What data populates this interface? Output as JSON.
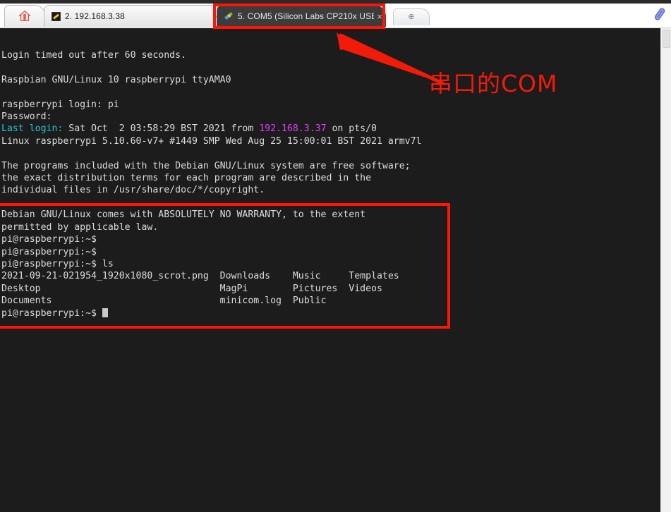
{
  "tabbar": {
    "home_tab": {
      "name": "home-tab",
      "icon": "home-icon",
      "label": ""
    },
    "tabs": [
      {
        "label": "2. 192.168.3.38",
        "icon": "ssh-session-icon",
        "close_label": "×",
        "active": false
      },
      {
        "label": "5. COM5  (Silicon Labs CP210x USB",
        "icon": "serial-plug-icon",
        "close_label": "×",
        "active": true
      }
    ],
    "new_tab_label": "⊕",
    "clip_icon": "paperclip-icon"
  },
  "terminal": {
    "lines": [
      {
        "segments": [
          {
            "text": "Login timed out after 60 seconds."
          }
        ]
      },
      {
        "segments": [
          {
            "text": ""
          }
        ]
      },
      {
        "segments": [
          {
            "text": "Raspbian GNU/Linux 10 raspberrypi ttyAMA0"
          }
        ]
      },
      {
        "segments": [
          {
            "text": ""
          }
        ]
      },
      {
        "segments": [
          {
            "text": "raspberrypi login: pi"
          }
        ]
      },
      {
        "segments": [
          {
            "text": "Password:"
          }
        ]
      },
      {
        "segments": [
          {
            "text": "Last login:",
            "color": "cyan"
          },
          {
            "text": " Sat Oct  2 03:58:29 BST 2021 from "
          },
          {
            "text": "192.168.3.37",
            "color": "magenta"
          },
          {
            "text": " on pts/0"
          }
        ]
      },
      {
        "segments": [
          {
            "text": "Linux raspberrypi 5.10.60-v7+ #1449 SMP Wed Aug 25 15:00:01 BST 2021 armv7l"
          }
        ]
      },
      {
        "segments": [
          {
            "text": ""
          }
        ]
      },
      {
        "segments": [
          {
            "text": "The programs included with the Debian GNU/Linux system are free software;"
          }
        ]
      },
      {
        "segments": [
          {
            "text": "the exact distribution terms for each program are described in the"
          }
        ]
      },
      {
        "segments": [
          {
            "text": "individual files in /usr/share/doc/*/copyright."
          }
        ]
      },
      {
        "segments": [
          {
            "text": ""
          }
        ]
      },
      {
        "segments": [
          {
            "text": "Debian GNU/Linux comes with ABSOLUTELY NO WARRANTY, to the extent"
          }
        ]
      },
      {
        "segments": [
          {
            "text": "permitted by applicable law."
          }
        ]
      },
      {
        "segments": [
          {
            "text": "pi@raspberrypi:~$"
          }
        ]
      },
      {
        "segments": [
          {
            "text": "pi@raspberrypi:~$"
          }
        ]
      },
      {
        "segments": [
          {
            "text": "pi@raspberrypi:~$ ls"
          }
        ]
      },
      {
        "segments": [
          {
            "text": "2021-09-21-021954_1920x1080_scrot.png  Downloads    Music     Templates"
          }
        ]
      },
      {
        "segments": [
          {
            "text": "Desktop                                MagPi        Pictures  Videos"
          }
        ]
      },
      {
        "segments": [
          {
            "text": "Documents                              minicom.log  Public"
          }
        ]
      },
      {
        "segments": [
          {
            "text": "pi@raspberrypi:~$ ",
            "cursor": true
          }
        ]
      }
    ],
    "prompt": "pi@raspberrypi:~$",
    "last_command": "ls",
    "ls_output": {
      "col1": [
        "2021-09-21-021954_1920x1080_scrot.png",
        "Desktop",
        "Documents"
      ],
      "col2": [
        "Downloads",
        "MagPi",
        "minicom.log"
      ],
      "col3": [
        "Music",
        "Pictures",
        "Public"
      ],
      "col4": [
        "Templates",
        "Videos"
      ]
    },
    "colors": {
      "background": "#1c1c1c",
      "foreground": "#dcdcdc",
      "cyan": "#26c6da",
      "magenta": "#e040fb"
    }
  },
  "annotations": {
    "highlight_color": "#fb1605",
    "callout_text": "串口的COM",
    "boxes": [
      {
        "name": "active-tab-highlight"
      },
      {
        "name": "terminal-output-highlight"
      }
    ]
  }
}
